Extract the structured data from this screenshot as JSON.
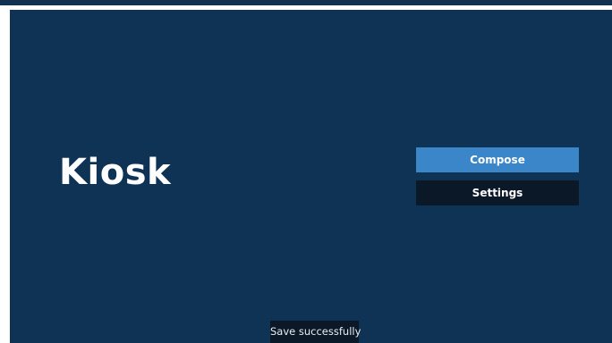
{
  "app": {
    "title": "Kiosk"
  },
  "menu": {
    "compose_label": "Compose",
    "settings_label": "Settings"
  },
  "toast": {
    "message": "Save successfully"
  },
  "colors": {
    "background": "#0f3355",
    "selected_button": "#3a86c9",
    "button": "#0b1828",
    "text": "#ffffff"
  }
}
